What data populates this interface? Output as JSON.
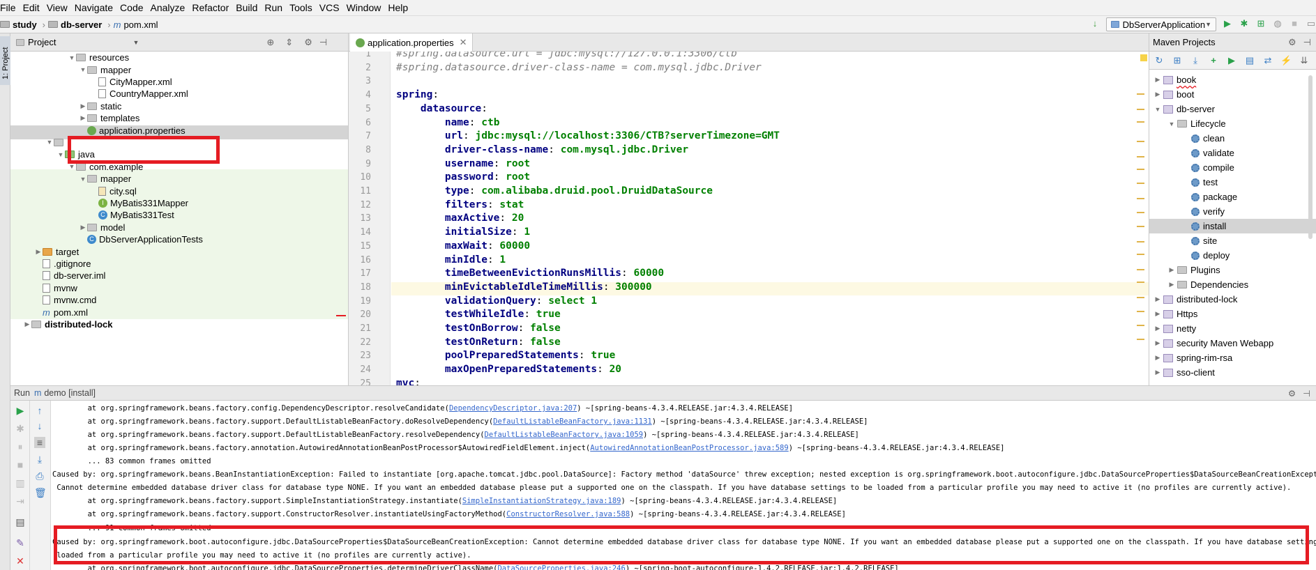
{
  "menu": [
    "File",
    "Edit",
    "View",
    "Navigate",
    "Code",
    "Analyze",
    "Refactor",
    "Build",
    "Run",
    "Tools",
    "VCS",
    "Window",
    "Help"
  ],
  "breadcrumb": [
    "study",
    "db-server",
    "pom.xml"
  ],
  "run_config": "DbServerApplication",
  "left_strip_label": "1: Project",
  "project_panel": {
    "title": "Project",
    "tree": [
      {
        "label": "resources",
        "indent": 5,
        "arrow": "▼",
        "icon": "folder"
      },
      {
        "label": "mapper",
        "indent": 6,
        "arrow": "▼",
        "icon": "folder"
      },
      {
        "label": "CityMapper.xml",
        "indent": 7,
        "arrow": "",
        "icon": "file"
      },
      {
        "label": "CountryMapper.xml",
        "indent": 7,
        "arrow": "",
        "icon": "file"
      },
      {
        "label": "static",
        "indent": 6,
        "arrow": "▶",
        "icon": "folder"
      },
      {
        "label": "templates",
        "indent": 6,
        "arrow": "▶",
        "icon": "folder"
      },
      {
        "label": "application.properties",
        "indent": 6,
        "arrow": "",
        "icon": "leaf"
      },
      {
        "label": "",
        "indent": 3,
        "arrow": "▼",
        "icon": "folder"
      },
      {
        "label": "java",
        "indent": 4,
        "arrow": "▼",
        "icon": "folder-green"
      },
      {
        "label": "com.example",
        "indent": 5,
        "arrow": "▼",
        "icon": "folder"
      },
      {
        "label": "mapper",
        "indent": 6,
        "arrow": "▼",
        "icon": "folder"
      },
      {
        "label": "city.sql",
        "indent": 7,
        "arrow": "",
        "icon": "sql"
      },
      {
        "label": "MyBatis331Mapper",
        "indent": 7,
        "arrow": "",
        "icon": "interface"
      },
      {
        "label": "MyBatis331Test",
        "indent": 7,
        "arrow": "",
        "icon": "class"
      },
      {
        "label": "model",
        "indent": 6,
        "arrow": "▶",
        "icon": "folder"
      },
      {
        "label": "DbServerApplicationTests",
        "indent": 6,
        "arrow": "",
        "icon": "class"
      },
      {
        "label": "target",
        "indent": 2,
        "arrow": "▶",
        "icon": "folder-orange"
      },
      {
        "label": ".gitignore",
        "indent": 2,
        "arrow": "",
        "icon": "file"
      },
      {
        "label": "db-server.iml",
        "indent": 2,
        "arrow": "",
        "icon": "file"
      },
      {
        "label": "mvnw",
        "indent": 2,
        "arrow": "",
        "icon": "file"
      },
      {
        "label": "mvnw.cmd",
        "indent": 2,
        "arrow": "",
        "icon": "file"
      },
      {
        "label": "pom.xml",
        "indent": 2,
        "arrow": "",
        "icon": "m"
      },
      {
        "label": "distributed-lock",
        "indent": 1,
        "arrow": "▶",
        "icon": "folder"
      }
    ]
  },
  "editor": {
    "tab_label": "application.properties",
    "lines": [
      {
        "n": "1",
        "segs": [
          {
            "t": "#spring.datasource.url = jdbc:mysql://127.0.0.1:3306/ctb",
            "c": "cmt"
          }
        ]
      },
      {
        "n": "2",
        "segs": [
          {
            "t": "#spring.datasource.driver-class-name = com.mysql.jdbc.Driver",
            "c": "cmt"
          }
        ]
      },
      {
        "n": "3",
        "segs": []
      },
      {
        "n": "4",
        "segs": [
          {
            "t": "spring",
            "c": "key"
          },
          {
            "t": ":",
            "c": ""
          }
        ]
      },
      {
        "n": "5",
        "segs": [
          {
            "t": "    datasource",
            "c": "key"
          },
          {
            "t": ":",
            "c": ""
          }
        ]
      },
      {
        "n": "6",
        "segs": [
          {
            "t": "        name",
            "c": "key"
          },
          {
            "t": ": ",
            "c": ""
          },
          {
            "t": "ctb",
            "c": "val"
          }
        ]
      },
      {
        "n": "7",
        "segs": [
          {
            "t": "        url",
            "c": "key"
          },
          {
            "t": ": ",
            "c": ""
          },
          {
            "t": "jdbc:mysql://localhost:3306/CTB?serverTimezone=GMT",
            "c": "val"
          }
        ]
      },
      {
        "n": "8",
        "segs": [
          {
            "t": "        driver-class-name",
            "c": "key"
          },
          {
            "t": ": ",
            "c": ""
          },
          {
            "t": "com.mysql.jdbc.Driver",
            "c": "val"
          }
        ]
      },
      {
        "n": "9",
        "segs": [
          {
            "t": "        username",
            "c": "key"
          },
          {
            "t": ": ",
            "c": ""
          },
          {
            "t": "root",
            "c": "val"
          }
        ]
      },
      {
        "n": "10",
        "segs": [
          {
            "t": "        password",
            "c": "key"
          },
          {
            "t": ": ",
            "c": ""
          },
          {
            "t": "root",
            "c": "val"
          }
        ]
      },
      {
        "n": "11",
        "segs": [
          {
            "t": "        type",
            "c": "key"
          },
          {
            "t": ": ",
            "c": ""
          },
          {
            "t": "com.alibaba.druid.pool.DruidDataSource",
            "c": "val"
          }
        ]
      },
      {
        "n": "12",
        "segs": [
          {
            "t": "        filters",
            "c": "key"
          },
          {
            "t": ": ",
            "c": ""
          },
          {
            "t": "stat",
            "c": "val"
          }
        ]
      },
      {
        "n": "13",
        "segs": [
          {
            "t": "        maxActive",
            "c": "key"
          },
          {
            "t": ": ",
            "c": ""
          },
          {
            "t": "20",
            "c": "val"
          }
        ]
      },
      {
        "n": "14",
        "segs": [
          {
            "t": "        initialSize",
            "c": "key"
          },
          {
            "t": ": ",
            "c": ""
          },
          {
            "t": "1",
            "c": "val"
          }
        ]
      },
      {
        "n": "15",
        "segs": [
          {
            "t": "        maxWait",
            "c": "key"
          },
          {
            "t": ": ",
            "c": ""
          },
          {
            "t": "60000",
            "c": "val"
          }
        ]
      },
      {
        "n": "16",
        "segs": [
          {
            "t": "        minIdle",
            "c": "key"
          },
          {
            "t": ": ",
            "c": ""
          },
          {
            "t": "1",
            "c": "val"
          }
        ]
      },
      {
        "n": "17",
        "segs": [
          {
            "t": "        timeBetweenEvictionRunsMillis",
            "c": "key"
          },
          {
            "t": ": ",
            "c": ""
          },
          {
            "t": "60000",
            "c": "val"
          }
        ]
      },
      {
        "n": "18",
        "segs": [
          {
            "t": "        minEvictableIdleTimeMillis",
            "c": "key"
          },
          {
            "t": ": ",
            "c": ""
          },
          {
            "t": "300000",
            "c": "val"
          }
        ]
      },
      {
        "n": "19",
        "segs": [
          {
            "t": "        validationQuery",
            "c": "key"
          },
          {
            "t": ": ",
            "c": ""
          },
          {
            "t": "select 1",
            "c": "val"
          }
        ]
      },
      {
        "n": "20",
        "segs": [
          {
            "t": "        testWhileIdle",
            "c": "key"
          },
          {
            "t": ": ",
            "c": ""
          },
          {
            "t": "true",
            "c": "val"
          }
        ]
      },
      {
        "n": "21",
        "segs": [
          {
            "t": "        testOnBorrow",
            "c": "key"
          },
          {
            "t": ": ",
            "c": ""
          },
          {
            "t": "false",
            "c": "val"
          }
        ]
      },
      {
        "n": "22",
        "segs": [
          {
            "t": "        testOnReturn",
            "c": "key"
          },
          {
            "t": ": ",
            "c": ""
          },
          {
            "t": "false",
            "c": "val"
          }
        ]
      },
      {
        "n": "23",
        "segs": [
          {
            "t": "        poolPreparedStatements",
            "c": "key"
          },
          {
            "t": ": ",
            "c": ""
          },
          {
            "t": "true",
            "c": "val"
          }
        ]
      },
      {
        "n": "24",
        "segs": [
          {
            "t": "        maxOpenPreparedStatements",
            "c": "key"
          },
          {
            "t": ": ",
            "c": ""
          },
          {
            "t": "20",
            "c": "val"
          }
        ]
      },
      {
        "n": "25",
        "segs": [
          {
            "t": "mvc",
            "c": "key"
          },
          {
            "t": ":",
            "c": ""
          }
        ]
      }
    ]
  },
  "maven": {
    "title": "Maven Projects",
    "items": [
      {
        "label": "book",
        "indent": 0,
        "arrow": "▶",
        "icon": "mod"
      },
      {
        "label": "boot",
        "indent": 0,
        "arrow": "▶",
        "icon": "mod"
      },
      {
        "label": "db-server",
        "indent": 0,
        "arrow": "▼",
        "icon": "mod"
      },
      {
        "label": "Lifecycle",
        "indent": 1,
        "arrow": "▼",
        "icon": "folder"
      },
      {
        "label": "clean",
        "indent": 2,
        "arrow": "",
        "icon": "gear"
      },
      {
        "label": "validate",
        "indent": 2,
        "arrow": "",
        "icon": "gear"
      },
      {
        "label": "compile",
        "indent": 2,
        "arrow": "",
        "icon": "gear"
      },
      {
        "label": "test",
        "indent": 2,
        "arrow": "",
        "icon": "gear"
      },
      {
        "label": "package",
        "indent": 2,
        "arrow": "",
        "icon": "gear"
      },
      {
        "label": "verify",
        "indent": 2,
        "arrow": "",
        "icon": "gear"
      },
      {
        "label": "install",
        "indent": 2,
        "arrow": "",
        "icon": "gear",
        "selected": true
      },
      {
        "label": "site",
        "indent": 2,
        "arrow": "",
        "icon": "gear"
      },
      {
        "label": "deploy",
        "indent": 2,
        "arrow": "",
        "icon": "gear"
      },
      {
        "label": "Plugins",
        "indent": 1,
        "arrow": "▶",
        "icon": "folder"
      },
      {
        "label": "Dependencies",
        "indent": 1,
        "arrow": "▶",
        "icon": "folder"
      },
      {
        "label": "distributed-lock",
        "indent": 0,
        "arrow": "▶",
        "icon": "mod"
      },
      {
        "label": "Https",
        "indent": 0,
        "arrow": "▶",
        "icon": "mod"
      },
      {
        "label": "netty",
        "indent": 0,
        "arrow": "▶",
        "icon": "mod"
      },
      {
        "label": "security Maven Webapp",
        "indent": 0,
        "arrow": "▶",
        "icon": "mod"
      },
      {
        "label": "spring-rim-rsa",
        "indent": 0,
        "arrow": "▶",
        "icon": "mod"
      },
      {
        "label": "sso-client",
        "indent": 0,
        "arrow": "▶",
        "icon": "mod"
      }
    ]
  },
  "run_panel": {
    "label": "Run",
    "config": "demo [install]",
    "lines": [
      {
        "segs": [
          {
            "t": "        at org.springframework.beans.factory.config.DependencyDescriptor.resolveCandidate("
          },
          {
            "t": "DependencyDescriptor.java:207",
            "l": true
          },
          {
            "t": ") ~[spring-beans-4.3.4.RELEASE.jar:4.3.4.RELEASE]"
          }
        ]
      },
      {
        "segs": [
          {
            "t": "        at org.springframework.beans.factory.support.DefaultListableBeanFactory.doResolveDependency("
          },
          {
            "t": "DefaultListableBeanFactory.java:1131",
            "l": true
          },
          {
            "t": ") ~[spring-beans-4.3.4.RELEASE.jar:4.3.4.RELEASE]"
          }
        ]
      },
      {
        "segs": [
          {
            "t": "        at org.springframework.beans.factory.support.DefaultListableBeanFactory.resolveDependency("
          },
          {
            "t": "DefaultListableBeanFactory.java:1059",
            "l": true
          },
          {
            "t": ") ~[spring-beans-4.3.4.RELEASE.jar:4.3.4.RELEASE]"
          }
        ]
      },
      {
        "segs": [
          {
            "t": "        at org.springframework.beans.factory.annotation.AutowiredAnnotationBeanPostProcessor$AutowiredFieldElement.inject("
          },
          {
            "t": "AutowiredAnnotationBeanPostProcessor.java:589",
            "l": true
          },
          {
            "t": ") ~[spring-beans-4.3.4.RELEASE.jar:4.3.4.RELEASE]"
          }
        ]
      },
      {
        "segs": [
          {
            "t": "        ... 83 common frames omitted"
          }
        ]
      },
      {
        "segs": [
          {
            "t": "Caused by: org.springframework.beans.BeanInstantiationException: Failed to instantiate [org.apache.tomcat.jdbc.pool.DataSource]: Factory method 'dataSource' threw exception; nested exception is org.springframework.boot.autoconfigure.jdbc.DataSourceProperties$DataSourceBeanCreationException:"
          }
        ]
      },
      {
        "segs": [
          {
            "t": " Cannot determine embedded database driver class for database type NONE. If you want an embedded database please put a supported one on the classpath. If you have database settings to be loaded from a particular profile you may need to active it (no profiles are currently active)."
          }
        ]
      },
      {
        "segs": [
          {
            "t": "        at org.springframework.beans.factory.support.SimpleInstantiationStrategy.instantiate("
          },
          {
            "t": "SimpleInstantiationStrategy.java:189",
            "l": true
          },
          {
            "t": ") ~[spring-beans-4.3.4.RELEASE.jar:4.3.4.RELEASE]"
          }
        ]
      },
      {
        "segs": [
          {
            "t": "        at org.springframework.beans.factory.support.ConstructorResolver.instantiateUsingFactoryMethod("
          },
          {
            "t": "ConstructorResolver.java:588",
            "l": true
          },
          {
            "t": ") ~[spring-beans-4.3.4.RELEASE.jar:4.3.4.RELEASE]"
          }
        ]
      },
      {
        "segs": [
          {
            "t": "        ... 91 common frames omitted"
          }
        ]
      },
      {
        "segs": [
          {
            "t": "Caused by: org.springframework.boot.autoconfigure.jdbc.DataSourceProperties$DataSourceBeanCreationException: Cannot determine embedded database driver class for database type NONE. If you want an embedded database please put a supported one on the classpath. If you have database settings to be"
          }
        ]
      },
      {
        "segs": [
          {
            "t": " loaded from a particular profile you may need to active it (no profiles are currently active)."
          }
        ]
      },
      {
        "segs": [
          {
            "t": "        at org.springframework.boot.autoconfigure.jdbc.DataSourceProperties.determineDriverClassName("
          },
          {
            "t": "DataSourceProperties.java:246",
            "l": true
          },
          {
            "t": ") ~[spring-boot-autoconfigure-1.4.2.RELEASE.jar:1.4.2.RELEASE]"
          }
        ]
      }
    ]
  },
  "highlight_color": "#e51c23"
}
